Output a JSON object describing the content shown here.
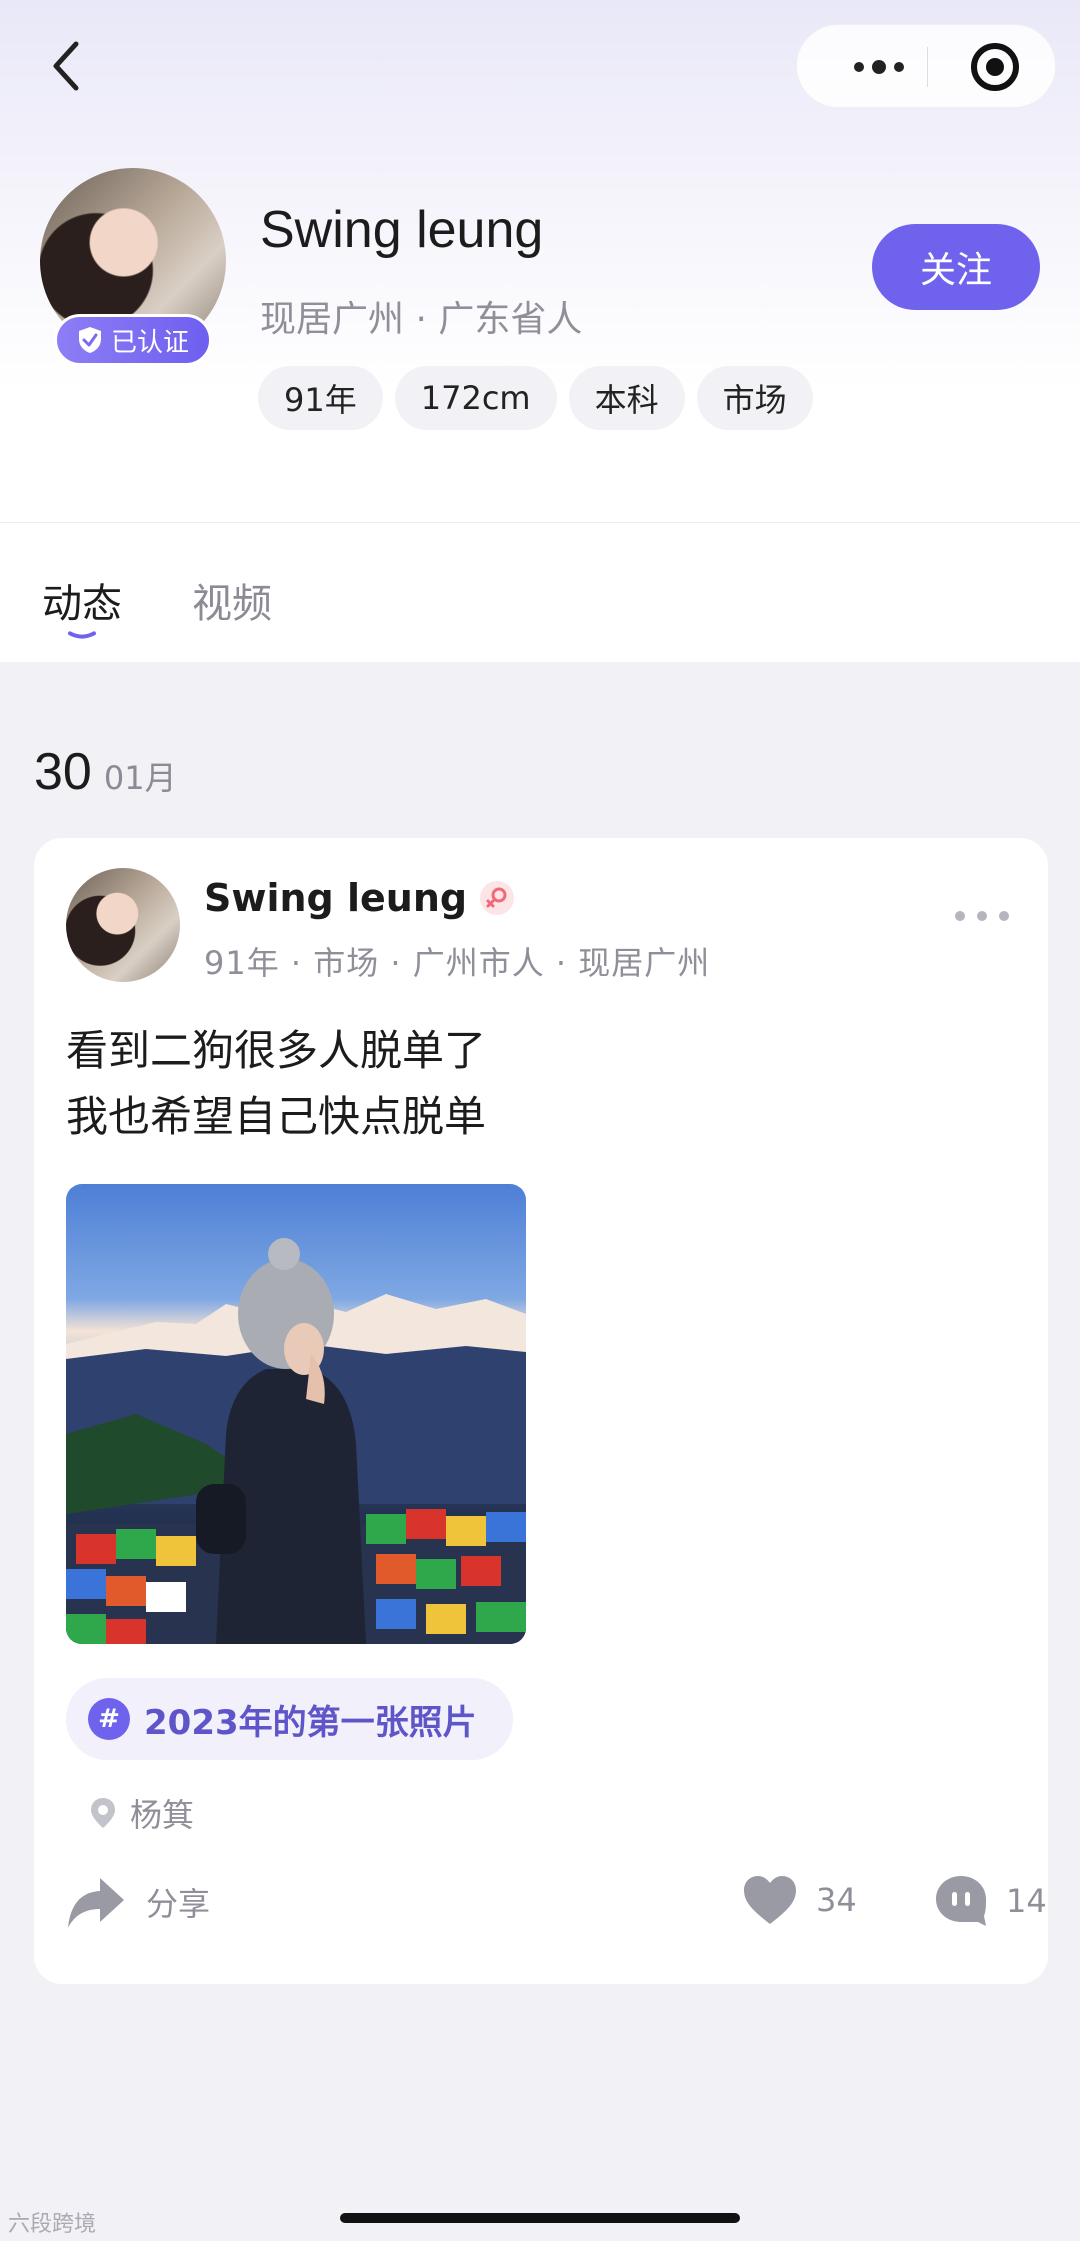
{
  "nav": {
    "back_icon": "chevron-left-icon",
    "more_icon": "more-dots-icon",
    "close_icon": "target-icon"
  },
  "profile": {
    "name": "Swing leung",
    "location": "现居广州 · 广东省人",
    "verified_label": "已认证",
    "follow_label": "关注",
    "tags": [
      "91年",
      "172cm",
      "本科",
      "市场"
    ]
  },
  "tabs": [
    {
      "label": "动态"
    },
    {
      "label": "视频"
    }
  ],
  "feed": {
    "date_day": "30",
    "date_month": "01月",
    "post": {
      "author": "Swing leung",
      "meta": "91年 · 市场 · 广州市人 · 现居广州",
      "text_line1": "看到二狗很多人脱单了",
      "text_line2": "我也希望自己快点脱单",
      "topic": "2023年的第一张照片",
      "topic_icon": "#",
      "place": "杨箕",
      "share_label": "分享",
      "likes": "34",
      "comments": "14"
    }
  },
  "watermark": "六段跨境",
  "colors": {
    "accent": "#6f63ee",
    "muted": "#8f8f99",
    "background": "#f1f1f6"
  }
}
